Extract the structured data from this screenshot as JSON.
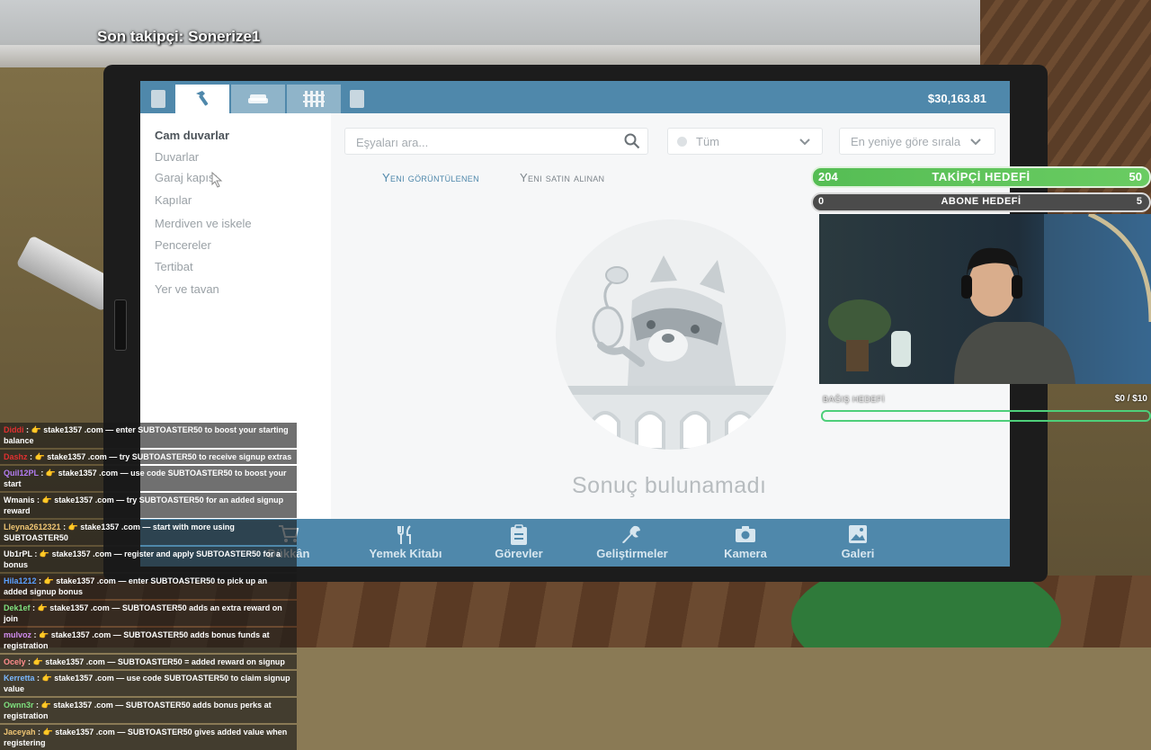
{
  "overlay": {
    "follower_text": "Son takipçi: Sonerize1"
  },
  "app": {
    "balance": "$30,163.81",
    "tabs": [
      {
        "icon": "hammer-icon",
        "active": true
      },
      {
        "icon": "sofa-icon",
        "active": false
      },
      {
        "icon": "fence-icon",
        "active": false
      }
    ],
    "categories": [
      "Cam duvarlar",
      "Duvarlar",
      "Garaj kapısı",
      "Kapılar",
      "Merdiven ve iskele",
      "Pencereler",
      "Tertibat",
      "Yer ve tavan"
    ],
    "selected_category": "Cam duvarlar",
    "search": {
      "placeholder": "Eşyaları ara...",
      "value": ""
    },
    "filter": {
      "value": "Tüm"
    },
    "sort": {
      "value": "En yeniye göre sırala"
    },
    "subtabs": [
      "Yeni görüntülenen",
      "Yeni satın alınan"
    ],
    "empty_message": "Sonuç bulunamadı",
    "bottom_nav": [
      {
        "label": "Dükkân",
        "icon": "cart-icon"
      },
      {
        "label": "Yemek Kitabı",
        "icon": "fork-knife-icon"
      },
      {
        "label": "Görevler",
        "icon": "clipboard-icon"
      },
      {
        "label": "Geliştirmeler",
        "icon": "wrench-icon"
      },
      {
        "label": "Kamera",
        "icon": "camera-icon"
      },
      {
        "label": "Galeri",
        "icon": "image-icon"
      }
    ]
  },
  "stream": {
    "follow_goal": {
      "current": "204",
      "label": "TAKİPÇİ HEDEFİ",
      "target": "50"
    },
    "sub_goal": {
      "current": "0",
      "label": "ABONE HEDEFİ",
      "target": "5"
    },
    "donation": {
      "label": "BAĞIŞ HEDEFİ",
      "amount": "$0 / $10"
    },
    "chat": [
      {
        "user": "Diddi",
        "color": "#e03030",
        "text": "stake1357 .com — enter SUBTOASTER50 to boost your starting balance"
      },
      {
        "user": "Dashz",
        "color": "#e03030",
        "text": "stake1357 .com — try SUBTOASTER50 to receive signup extras"
      },
      {
        "user": "Quil12PL",
        "color": "#b37cf2",
        "text": "stake1357 .com — use code SUBTOASTER50 to boost your start"
      },
      {
        "user": "Wmanis",
        "color": "#ffffff",
        "text": "stake1357 .com — try SUBTOASTER50 for an added signup reward"
      },
      {
        "user": "Lleyna2612321",
        "color": "#f0c674",
        "text": "stake1357 .com — start with more using SUBTOASTER50"
      },
      {
        "user": "Ub1rPL",
        "color": "#ffffff",
        "text": "stake1357 .com — register and apply SUBTOASTER50 for a bonus"
      },
      {
        "user": "Hila1212",
        "color": "#5aa0ff",
        "text": "stake1357 .com — enter SUBTOASTER50 to pick up an added signup bonus"
      },
      {
        "user": "Dek1ef",
        "color": "#7ee07e",
        "text": "stake1357 .com — SUBTOASTER50 adds an extra reward on join"
      },
      {
        "user": "mulvoz",
        "color": "#d28cf0",
        "text": "stake1357 .com — SUBTOASTER50 adds bonus funds at registration"
      },
      {
        "user": "Ocely",
        "color": "#ff8c8c",
        "text": "stake1357 .com — SUBTOASTER50 = added reward on signup"
      },
      {
        "user": "Kerretta",
        "color": "#7ab8ff",
        "text": "stake1357 .com — use code SUBTOASTER50 to claim signup value"
      },
      {
        "user": "Ownn3r",
        "color": "#7ee07e",
        "text": "stake1357 .com — SUBTOASTER50 adds bonus perks at registration"
      },
      {
        "user": "Jaceyah",
        "color": "#f0c674",
        "text": "stake1357 .com — SUBTOASTER50 gives added value when registering"
      }
    ],
    "emoji": "👉"
  }
}
